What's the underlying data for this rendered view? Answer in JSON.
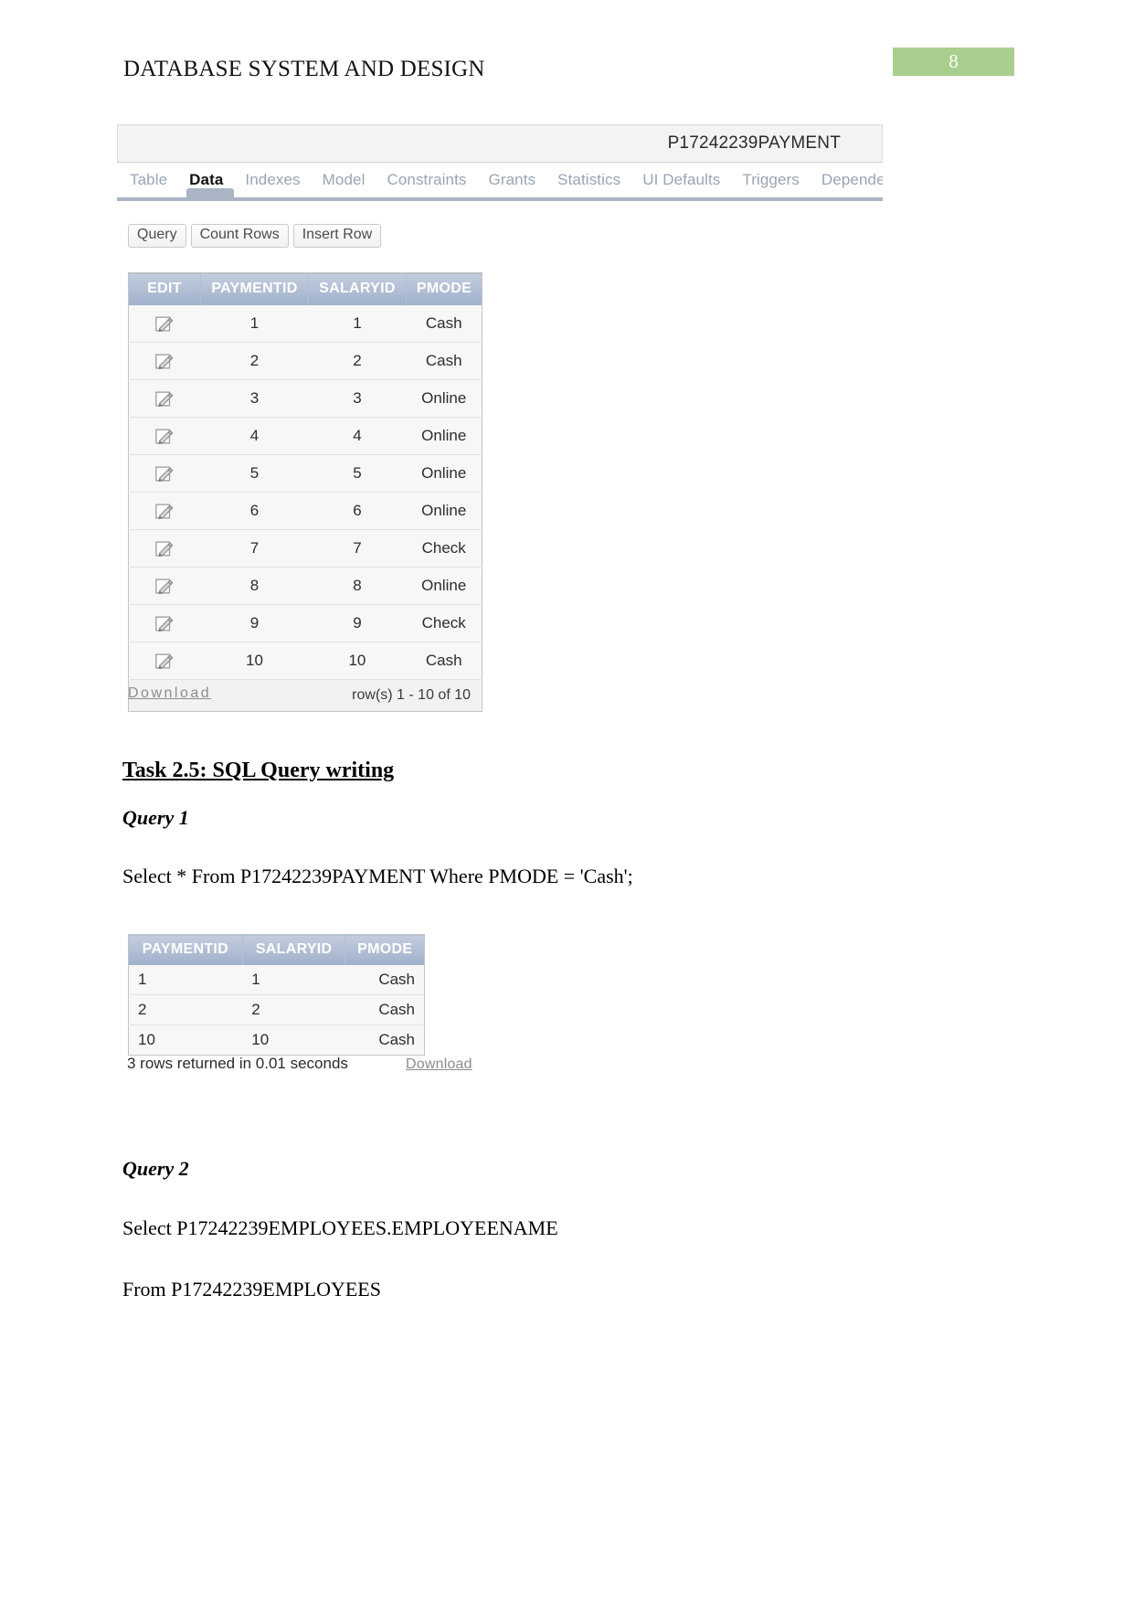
{
  "header": {
    "document_title": "DATABASE SYSTEM AND DESIGN",
    "page_number": "8",
    "badge_color": "#a9ce8e"
  },
  "apex_screenshot": {
    "table_name": "P17242239PAYMENT",
    "tabs": [
      {
        "label": "Table",
        "active": false
      },
      {
        "label": "Data",
        "active": true
      },
      {
        "label": "Indexes",
        "active": false
      },
      {
        "label": "Model",
        "active": false
      },
      {
        "label": "Constraints",
        "active": false
      },
      {
        "label": "Grants",
        "active": false
      },
      {
        "label": "Statistics",
        "active": false
      },
      {
        "label": "UI Defaults",
        "active": false
      },
      {
        "label": "Triggers",
        "active": false
      },
      {
        "label": "Dependenci",
        "active": false
      }
    ],
    "buttons": [
      {
        "label": "Query"
      },
      {
        "label": "Count Rows"
      },
      {
        "label": "Insert Row"
      }
    ],
    "report": {
      "columns": [
        "EDIT",
        "PAYMENTID",
        "SALARYID",
        "PMODE"
      ],
      "rows": [
        {
          "edit_icon": "edit-pencil-icon",
          "paymentid": "1",
          "salaryid": "1",
          "pmode": "Cash"
        },
        {
          "edit_icon": "edit-pencil-icon",
          "paymentid": "2",
          "salaryid": "2",
          "pmode": "Cash"
        },
        {
          "edit_icon": "edit-pencil-icon",
          "paymentid": "3",
          "salaryid": "3",
          "pmode": "Online"
        },
        {
          "edit_icon": "edit-pencil-icon",
          "paymentid": "4",
          "salaryid": "4",
          "pmode": "Online"
        },
        {
          "edit_icon": "edit-pencil-icon",
          "paymentid": "5",
          "salaryid": "5",
          "pmode": "Online"
        },
        {
          "edit_icon": "edit-pencil-icon",
          "paymentid": "6",
          "salaryid": "6",
          "pmode": "Online"
        },
        {
          "edit_icon": "edit-pencil-icon",
          "paymentid": "7",
          "salaryid": "7",
          "pmode": "Check"
        },
        {
          "edit_icon": "edit-pencil-icon",
          "paymentid": "8",
          "salaryid": "8",
          "pmode": "Online"
        },
        {
          "edit_icon": "edit-pencil-icon",
          "paymentid": "9",
          "salaryid": "9",
          "pmode": "Check"
        },
        {
          "edit_icon": "edit-pencil-icon",
          "paymentid": "10",
          "salaryid": "10",
          "pmode": "Cash"
        }
      ],
      "footer": "row(s) 1 - 10 of 10",
      "download_label": "Download"
    }
  },
  "body": {
    "task_heading": "Task 2.5: SQL Query writing ",
    "query1_heading": "Query 1",
    "query1_sql": "Select * From P17242239PAYMENT Where PMODE = 'Cash';",
    "query2_heading": "Query 2",
    "query2_line1": "Select P17242239EMPLOYEES.EMPLOYEENAME",
    "query2_line2": "From P17242239EMPLOYEES"
  },
  "query1_result": {
    "columns": [
      "PAYMENTID",
      "SALARYID",
      "PMODE"
    ],
    "rows": [
      {
        "paymentid": "1",
        "salaryid": "1",
        "pmode": "Cash"
      },
      {
        "paymentid": "2",
        "salaryid": "2",
        "pmode": "Cash"
      },
      {
        "paymentid": "10",
        "salaryid": "10",
        "pmode": "Cash"
      }
    ],
    "status": "3 rows returned in 0.01 seconds",
    "download_label": "Download"
  }
}
